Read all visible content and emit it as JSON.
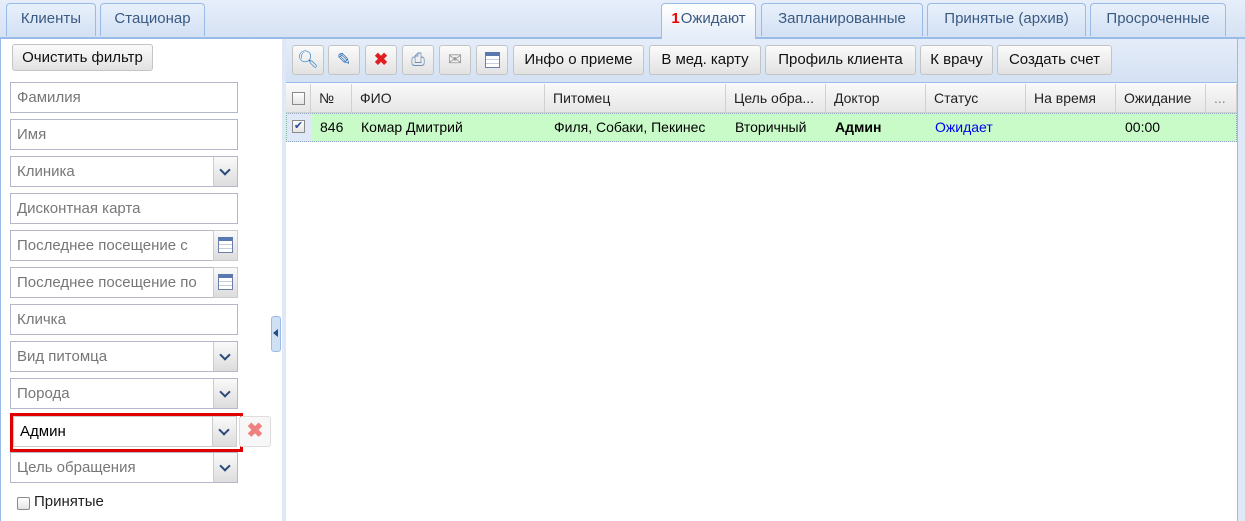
{
  "left_tabs": [
    {
      "label": "Клиенты"
    },
    {
      "label": "Стационар"
    }
  ],
  "right_tabs": [
    {
      "label": "Ожидают",
      "badge": "1",
      "active": true
    },
    {
      "label": "Запланированные"
    },
    {
      "label": "Принятые (архив)"
    },
    {
      "label": "Просроченные"
    }
  ],
  "filter": {
    "clear_label": "Очистить фильтр",
    "fields": [
      {
        "placeholder": "Фамилия",
        "type": "text"
      },
      {
        "placeholder": "Имя",
        "type": "text"
      },
      {
        "placeholder": "Клиника",
        "type": "combo"
      },
      {
        "placeholder": "Дисконтная карта",
        "type": "text"
      },
      {
        "placeholder": "Последнее посещение с",
        "type": "date"
      },
      {
        "placeholder": "Последнее посещение по",
        "type": "date"
      },
      {
        "placeholder": "Кличка",
        "type": "text"
      },
      {
        "placeholder": "Вид питомца",
        "type": "combo"
      },
      {
        "placeholder": "Порода",
        "type": "combo"
      },
      {
        "value": "Админ",
        "type": "combo"
      },
      {
        "placeholder": "Цель обращения",
        "type": "combo"
      }
    ],
    "accepted_label": "Принятые"
  },
  "toolbar": {
    "icons": [
      "search-icon",
      "edit-icon",
      "delete-icon",
      "print-icon",
      "mail-icon",
      "calendar-icon"
    ],
    "buttons": [
      "Инфо о приеме",
      "В мед. карту",
      "Профиль клиента",
      "К врачу",
      "Создать счет"
    ]
  },
  "grid": {
    "columns": [
      "№",
      "ФИО",
      "Питомец",
      "Цель обра...",
      "Доктор",
      "Статус",
      "На время",
      "Ожидание",
      "..."
    ],
    "rows": [
      {
        "checked": true,
        "num": "846",
        "fio": "Комар Дмитрий",
        "pet": "Филя, Собаки, Пекинес",
        "purpose": "Вторичный",
        "doctor": "Админ",
        "status": "Ожидает",
        "time": "",
        "wait": "00:00"
      }
    ]
  },
  "colors": {
    "row": "#c9fbc9",
    "status": "#0000ee",
    "highlight": "#e00000"
  }
}
